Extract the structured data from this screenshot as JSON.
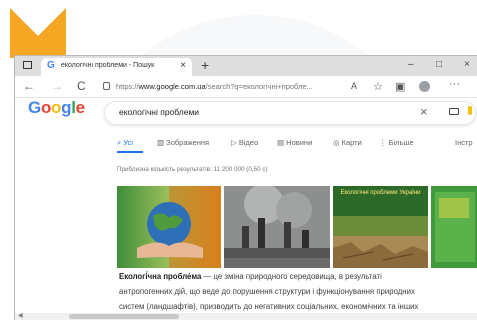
{
  "colors": {
    "accent_orange": "#f5a623",
    "google_blue": "#4285f4",
    "google_red": "#ea4335",
    "google_yellow": "#fbbc05",
    "google_green": "#34a853",
    "link_blue": "#1a73e8"
  },
  "browser": {
    "tab_title": "екологічні проблеми - Пошук",
    "tab_close": "×",
    "new_tab": "+",
    "controls": {
      "minimize": "–",
      "maximize": "□",
      "close": "×"
    },
    "nav": {
      "back": "←",
      "forward": "→",
      "reload": "C"
    },
    "url_prefix": "https://",
    "url_domain": "www.google.com.ua",
    "url_rest": "/search?q=екологічні+пробле..."
  },
  "google": {
    "logo_letters": [
      "G",
      "o",
      "o",
      "g",
      "l",
      "e"
    ],
    "query": "екологічні проблеми",
    "clear_icon": "×",
    "tabs": [
      "Усі",
      "Зображення",
      "Відео",
      "Новини",
      "Карти",
      "Більше",
      "Інстр"
    ],
    "tab_icons": [
      "search-icon",
      "image-icon",
      "video-icon",
      "news-icon",
      "map-pin-icon",
      "more-icon",
      "tools-icon"
    ],
    "results_count": "Приблизна кількість результатів: 11 200 000 (0,50 с)",
    "image_caption": "Екологічні проблеми України",
    "snippet": {
      "term": "Екологі́чна пробле́ма",
      "line1_rest": " — це зміна природного середовища, в результаті",
      "line2": "антропогенних дій, що веде до порушення структури і функціонування природних",
      "line3": "систем (ландшафтів), призводить до негативних соціальних, економічних та інших"
    }
  }
}
